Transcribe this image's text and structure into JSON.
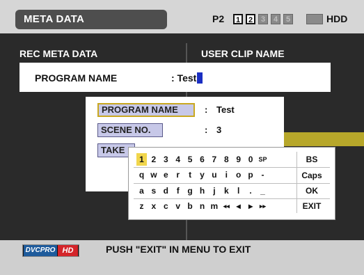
{
  "topbar": {
    "title": "META DATA",
    "media_label": "P2",
    "slots": [
      "1",
      "2",
      "3",
      "4",
      "5"
    ],
    "slots_active": [
      true,
      true,
      false,
      false,
      false
    ],
    "hdd_label": "HDD"
  },
  "panels": {
    "left_header": "REC META DATA",
    "right_header": "USER CLIP NAME"
  },
  "program": {
    "label": "PROGRAM NAME",
    "value": ": Test"
  },
  "fields": [
    {
      "label": "PROGRAM NAME",
      "colon": ":",
      "value": "Test",
      "selected": true
    },
    {
      "label": "SCENE NO.",
      "colon": ":",
      "value": "3",
      "selected": false
    },
    {
      "label": "TAKE",
      "colon": "",
      "value": "",
      "selected": false
    }
  ],
  "keyboard": {
    "rows": [
      [
        "1",
        "2",
        "3",
        "4",
        "5",
        "6",
        "7",
        "8",
        "9",
        "0",
        "SP"
      ],
      [
        "q",
        "w",
        "e",
        "r",
        "t",
        "y",
        "u",
        "i",
        "o",
        "p",
        "-"
      ],
      [
        "a",
        "s",
        "d",
        "f",
        "g",
        "h",
        "j",
        "k",
        "l",
        ".",
        "_"
      ],
      [
        "z",
        "x",
        "c",
        "v",
        "b",
        "n",
        "m",
        "◂◂",
        "◂",
        "▸",
        "▸▸"
      ]
    ],
    "function_keys": [
      "BS",
      "Caps",
      "OK",
      "EXIT"
    ],
    "highlighted_key": "1"
  },
  "bottombar": {
    "logo_part1": "DVCPRO",
    "logo_part2": "HD",
    "status": "PUSH \"EXIT\" IN MENU TO EXIT"
  },
  "colors": {
    "highlight": "#f1d64c",
    "cursor": "#1a2ec2",
    "field_bg": "#c7c8e8",
    "accent_strip": "#b7a72a"
  }
}
